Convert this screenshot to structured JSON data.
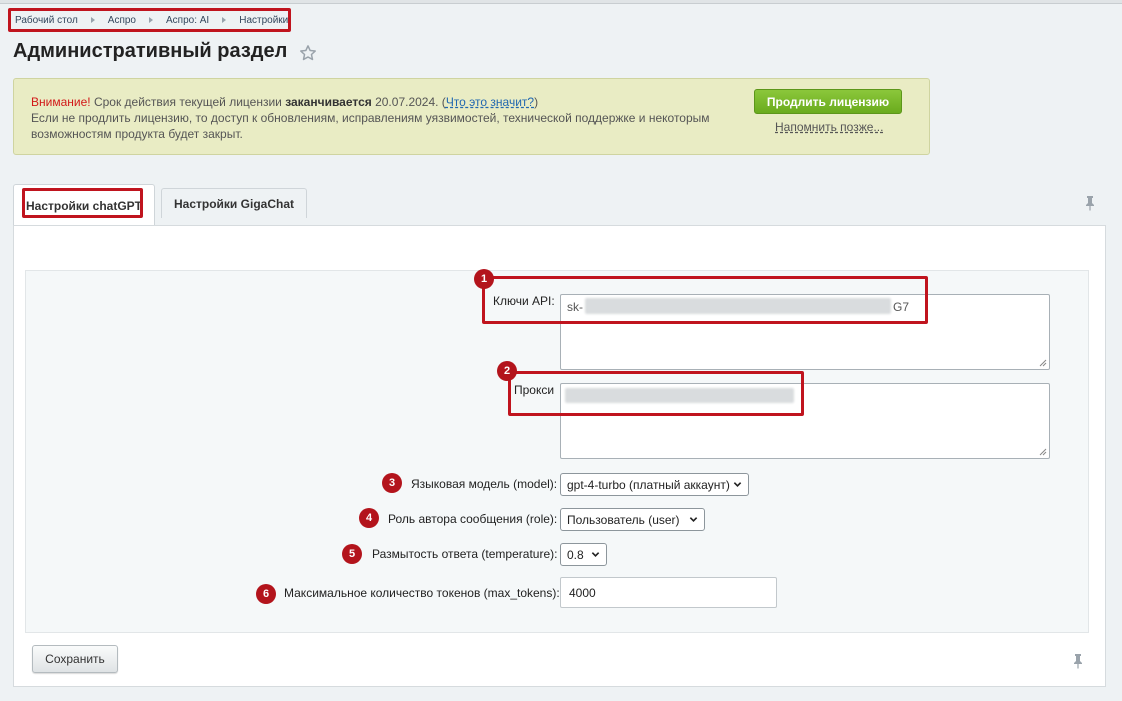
{
  "breadcrumbs": [
    "Рабочий стол",
    "Аспро",
    "Аспро: AI",
    "Настройки"
  ],
  "page_title": "Административный раздел",
  "license": {
    "warning_label": "Внимание!",
    "text_1": " Срок действия текущей лицензии ",
    "text_strong": "заканчивается",
    "date": " 20.07.2024. (",
    "link": "Что это значит?",
    "text_close": ")",
    "text_2": "Если не продлить лицензию, то доступ к обновлениям, исправлениям уязвимостей, технической поддержке и некоторым возможностям продукта будет закрыт.",
    "extend_button": "Продлить лицензию",
    "remind_link": "Напомнить позже..."
  },
  "tabs": [
    {
      "label": "Настройки chatGPT",
      "active": true
    },
    {
      "label": "Настройки GigaChat",
      "active": false
    }
  ],
  "form": {
    "api_keys": {
      "label": "Ключи API:",
      "value_start": "sk-",
      "value_end": "G7"
    },
    "proxy": {
      "label": "Прокси"
    },
    "model": {
      "label": "Языковая модель (model):",
      "value": "gpt-4-turbo (платный аккаунт)"
    },
    "role": {
      "label": "Роль автора сообщения (role):",
      "value": "Пользователь (user)"
    },
    "temperature": {
      "label": "Размытость ответа (temperature):",
      "value": "0.8"
    },
    "max_tokens": {
      "label": "Максимальное количество токенов (max_tokens):",
      "value": "4000"
    }
  },
  "badges": [
    "1",
    "2",
    "3",
    "4",
    "5",
    "6"
  ],
  "save_button": "Сохранить",
  "colors": {
    "highlight": "#c0141e",
    "badge": "#b3141c",
    "extend_button": "#7dbb2c"
  },
  "icons": [
    "star-icon",
    "pin-icon",
    "chevron-down-icon",
    "resize-handle-icon"
  ]
}
